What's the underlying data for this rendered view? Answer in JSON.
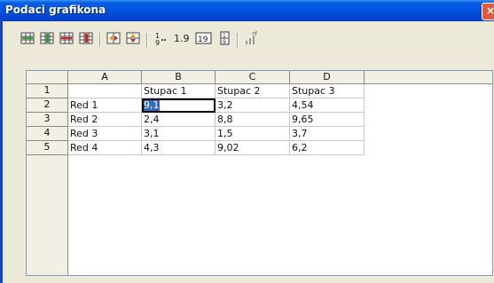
{
  "window": {
    "title": "Podaci grafikona",
    "close_glyph": "×"
  },
  "toolbar": {
    "icons": [
      "insert-row-icon",
      "insert-column-icon",
      "delete-row-icon",
      "delete-column-icon",
      "swap-columns-icon",
      "swap-rows-icon",
      "number-format-icon",
      "number-format-icon",
      "number-format-icon",
      "number-format-icon",
      "transfer-icon"
    ],
    "format1": "1.9",
    "format_box": "19"
  },
  "grid": {
    "columns": [
      "A",
      "B",
      "C",
      "D",
      ""
    ],
    "rows": [
      {
        "num": "1",
        "cells": [
          "",
          "Stupac 1",
          "Stupac 2",
          "Stupac 3"
        ]
      },
      {
        "num": "2",
        "cells": [
          "Red 1",
          "9,1",
          "3,2",
          "4,54"
        ]
      },
      {
        "num": "3",
        "cells": [
          "Red 2",
          "2,4",
          "8,8",
          "9,65"
        ]
      },
      {
        "num": "4",
        "cells": [
          "Red 3",
          "3,1",
          "1,5",
          "3,7"
        ]
      },
      {
        "num": "5",
        "cells": [
          "Red 4",
          "4,3",
          "9,02",
          "6,2"
        ]
      }
    ],
    "selected": "9,1"
  }
}
